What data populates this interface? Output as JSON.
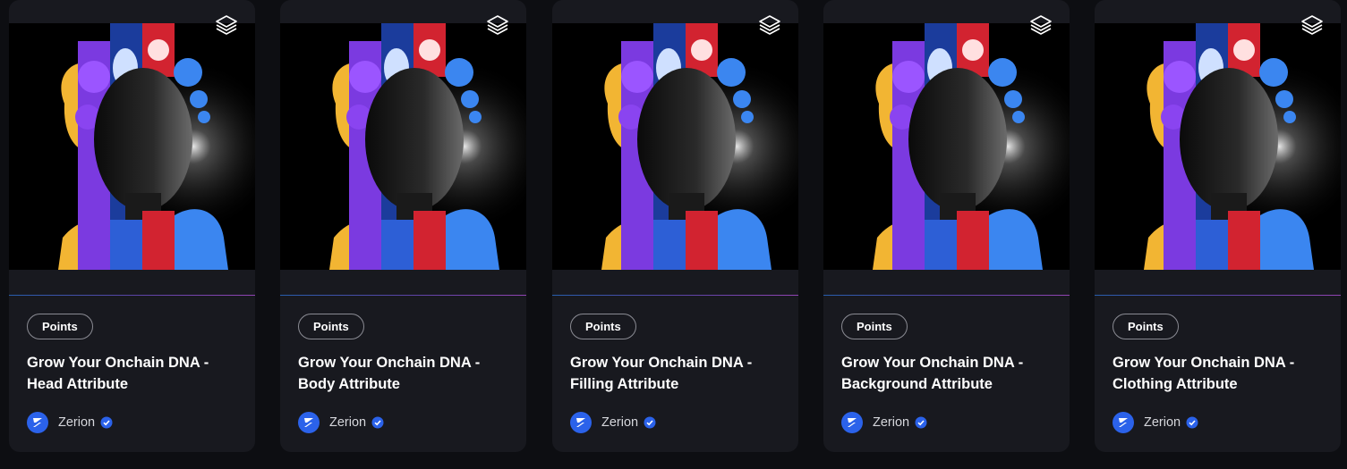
{
  "cards": [
    {
      "tag": "Points",
      "title": "Grow Your Onchain DNA - Head Attribute",
      "creator": "Zerion",
      "verified": true
    },
    {
      "tag": "Points",
      "title": "Grow Your Onchain DNA - Body Attribute",
      "creator": "Zerion",
      "verified": true
    },
    {
      "tag": "Points",
      "title": "Grow Your Onchain DNA - Filling Attribute",
      "creator": "Zerion",
      "verified": true
    },
    {
      "tag": "Points",
      "title": "Grow Your Onchain DNA - Background Attribute",
      "creator": "Zerion",
      "verified": true
    },
    {
      "tag": "Points",
      "title": "Grow Your Onchain DNA - Clothing Attribute",
      "creator": "Zerion",
      "verified": true
    }
  ],
  "icons": {
    "collection": "layers-icon",
    "creator_logo": "zerion-logo-icon",
    "verified": "verified-badge-icon"
  },
  "colors": {
    "accent": "#2b62ea",
    "card_bg": "#18191f",
    "page_bg": "#0d0e12"
  }
}
